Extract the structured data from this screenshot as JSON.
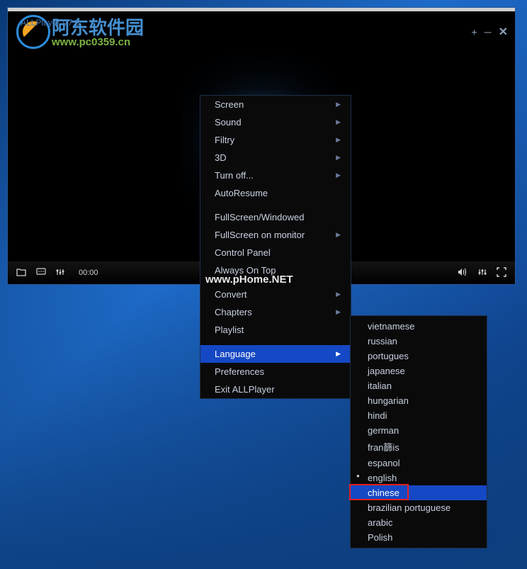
{
  "player": {
    "title": "ALLPlayer V7.3",
    "time": "00:00",
    "watermark_text": "阿东软件园",
    "watermark_url": "www.pc0359.cn",
    "center_watermark": "www.pHome.NET"
  },
  "menu": {
    "items": [
      {
        "label": "Screen",
        "submenu": true
      },
      {
        "label": "Sound",
        "submenu": true
      },
      {
        "label": "Filtry",
        "submenu": true
      },
      {
        "label": "3D",
        "submenu": true
      },
      {
        "label": "Turn off...",
        "submenu": true
      },
      {
        "label": "AutoResume",
        "submenu": false
      },
      {
        "label": "",
        "sep": true
      },
      {
        "label": "FullScreen/Windowed",
        "submenu": false
      },
      {
        "label": "FullScreen on monitor",
        "submenu": true
      },
      {
        "label": "Control Panel",
        "submenu": false
      },
      {
        "label": "Always On Top",
        "submenu": false
      },
      {
        "label": "",
        "sep": true
      },
      {
        "label": "Convert",
        "submenu": true
      },
      {
        "label": "Chapters",
        "submenu": true
      },
      {
        "label": "Playlist",
        "submenu": false
      },
      {
        "label": "",
        "sep": true
      },
      {
        "label": "Language",
        "submenu": true,
        "selected": true
      },
      {
        "label": "Preferences",
        "submenu": false
      },
      {
        "label": "Exit ALLPlayer",
        "submenu": false
      }
    ]
  },
  "languages": [
    {
      "label": "vietnamese"
    },
    {
      "label": "russian"
    },
    {
      "label": "portugues"
    },
    {
      "label": "japanese"
    },
    {
      "label": "italian"
    },
    {
      "label": "hungarian"
    },
    {
      "label": "hindi"
    },
    {
      "label": "german"
    },
    {
      "label": "fran篩is"
    },
    {
      "label": "espanol"
    },
    {
      "label": "english",
      "current": true
    },
    {
      "label": "chinese",
      "selected": true,
      "highlighted": true
    },
    {
      "label": "brazilian portuguese"
    },
    {
      "label": "arabic"
    },
    {
      "label": "Polish"
    }
  ]
}
